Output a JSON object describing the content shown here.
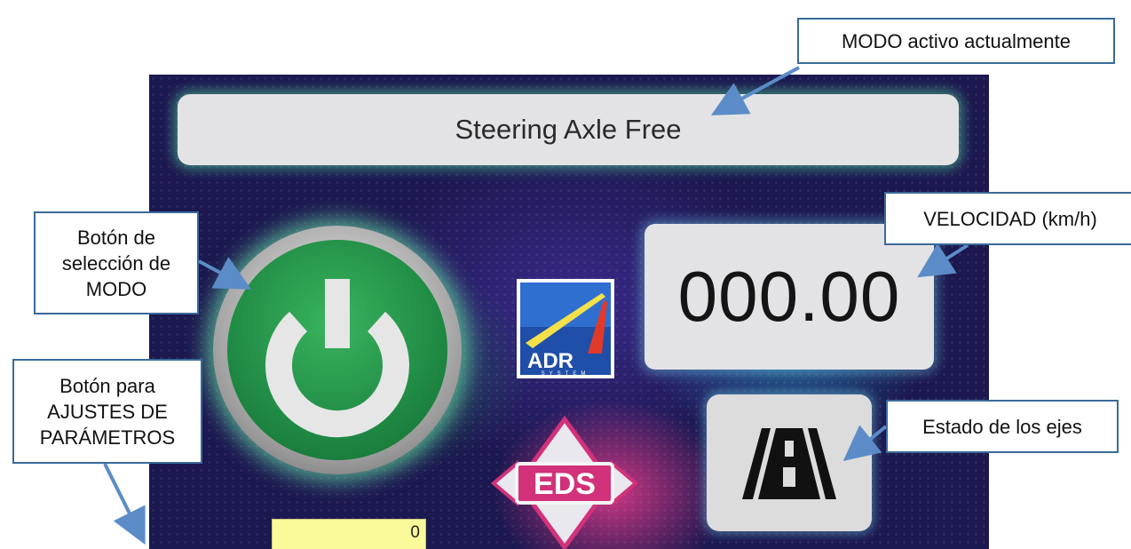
{
  "screen": {
    "mode_text": "Steering Axle Free",
    "speed_text": "000.00",
    "counter_value": "0",
    "logos": {
      "adr_text": "ADR",
      "adr_sub": "SYSTEM",
      "eds_text": "EDS"
    }
  },
  "callouts": {
    "mode_active": "MODO activo actualmente",
    "speed": "VELOCIDAD (km/h)",
    "mode_button": "Botón de\nselección de\nMODO",
    "settings_button": "Botón para\nAJUSTES DE\nPARÁMETROS",
    "axle_state": "Estado de los ejes"
  },
  "icons": {
    "power": "power-icon",
    "axle_state": "road-icon"
  },
  "colors": {
    "callout_border": "#3a6a9a",
    "power_green": "#1f8a44",
    "glow": "#6ef0aa",
    "counter_bg": "#fafa9a"
  }
}
